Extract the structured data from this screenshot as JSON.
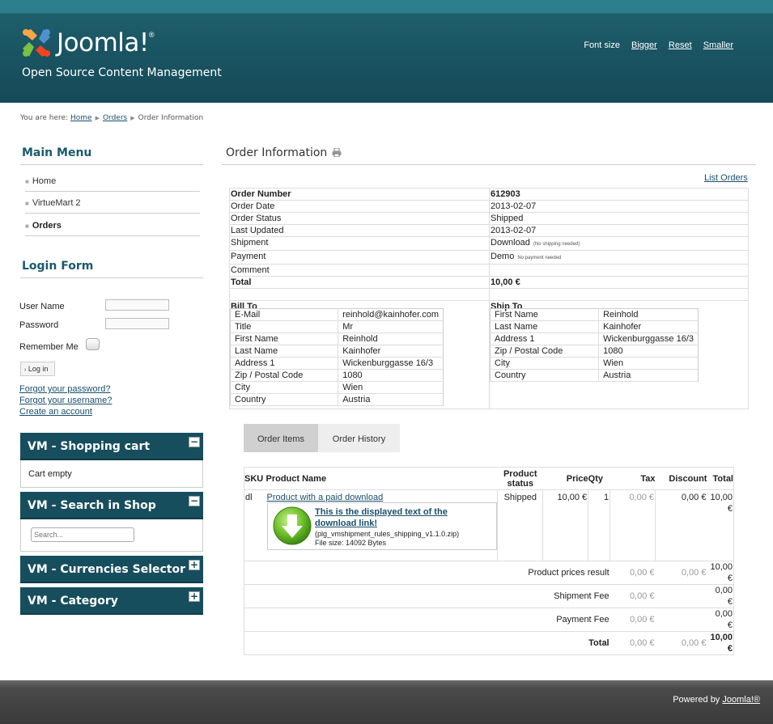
{
  "header": {
    "logo_text": "Joomla!",
    "tagline": "Open Source Content Management",
    "font_size_label": "Font size",
    "bigger": "Bigger",
    "reset": "Reset",
    "smaller": "Smaller"
  },
  "breadcrumb": {
    "prefix": "You are here:",
    "home": "Home",
    "orders": "Orders",
    "current": "Order Information"
  },
  "main_menu": {
    "title": "Main Menu",
    "items": [
      "Home",
      "VirtueMart 2",
      "Orders"
    ]
  },
  "login": {
    "title": "Login Form",
    "username_label": "User Name",
    "password_label": "Password",
    "remember_label": "Remember Me",
    "login_button": "Log in",
    "forgot_password": "Forgot your password?",
    "forgot_username": "Forgot your username?",
    "create_account": "Create an account"
  },
  "vm_modules": {
    "cart_title": "VM - Shopping cart",
    "cart_text": "Cart empty",
    "search_title": "VM - Search in Shop",
    "search_placeholder": "Search...",
    "currencies_title": "VM - Currencies Selector",
    "category_title": "VM - Category",
    "collapse_symbol": "−",
    "expand_symbol": "+"
  },
  "order": {
    "title": "Order Information",
    "list_orders": "List Orders",
    "rows": [
      {
        "label": "Order Number",
        "value": "612903",
        "bold": true
      },
      {
        "label": "Order Date",
        "value": "2013-02-07"
      },
      {
        "label": "Order Status",
        "value": "Shipped"
      },
      {
        "label": "Last Updated",
        "value": "2013-02-07"
      },
      {
        "label": "Shipment",
        "value": "Download",
        "note": "(No shipping needed)"
      },
      {
        "label": "Payment",
        "value": "Demo",
        "note": "No payment needed"
      },
      {
        "label": "Comment",
        "value": ""
      },
      {
        "label": "Total",
        "value": "10,00 €",
        "bold": true
      }
    ],
    "bill_to_title": "Bill To",
    "ship_to_title": "Ship To",
    "bill_to": [
      {
        "k": "E-Mail",
        "v": "reinhold@kainhofer.com"
      },
      {
        "k": "Title",
        "v": "Mr"
      },
      {
        "k": "First Name",
        "v": "Reinhold"
      },
      {
        "k": "Last Name",
        "v": "Kainhofer"
      },
      {
        "k": "Address 1",
        "v": "Wickenburggasse 16/3"
      },
      {
        "k": "Zip / Postal Code",
        "v": "1080"
      },
      {
        "k": "City",
        "v": "Wien"
      },
      {
        "k": "Country",
        "v": "Austria"
      }
    ],
    "ship_to": [
      {
        "k": "First Name",
        "v": "Reinhold"
      },
      {
        "k": "Last Name",
        "v": "Kainhofer"
      },
      {
        "k": "Address 1",
        "v": "Wickenburggasse 16/3"
      },
      {
        "k": "Zip / Postal Code",
        "v": "1080"
      },
      {
        "k": "City",
        "v": "Wien"
      },
      {
        "k": "Country",
        "v": "Austria"
      }
    ]
  },
  "tabs": [
    "Order Items",
    "Order History"
  ],
  "items": {
    "headers": {
      "sku": "SKU",
      "name": "Product Name",
      "status_1": "Product",
      "status_2": "status",
      "price": "Price",
      "qty": "Qty",
      "tax": "Tax",
      "discount": "Discount",
      "total": "Total"
    },
    "row": {
      "sku": "dl",
      "name": "Product with a paid download",
      "status": "Shipped",
      "price": "10,00 €",
      "qty": "1",
      "tax": "0,00 €",
      "discount": "0,00 €",
      "total": "10,00 €"
    },
    "download": {
      "link_text_1": "This is the displayed text of the",
      "link_text_2": "download link!",
      "filename": "(plg_vmshipment_rules_shipping_v1.1.0.zip)",
      "filesize": "File size: 14092 Bytes"
    },
    "summary": [
      {
        "label": "Product prices result",
        "tax": "0,00 €",
        "discount": "0,00 €",
        "total": "10,00 €"
      },
      {
        "label": "Shipment Fee",
        "tax": "0,00 €",
        "discount": "",
        "total": "0,00 €"
      },
      {
        "label": "Payment Fee",
        "tax": "0,00 €",
        "discount": "",
        "total": "0,00 €"
      },
      {
        "label": "Total",
        "tax": "0,00 €",
        "discount": "0,00 €",
        "total": "10,00 €",
        "bold": true
      }
    ]
  },
  "footer": {
    "powered_by": "Powered by",
    "joomla_link": "Joomla!®"
  },
  "colors": {
    "header_teal": "#1a5563",
    "module_head": "#174e5e",
    "link": "#1a4f6b"
  }
}
